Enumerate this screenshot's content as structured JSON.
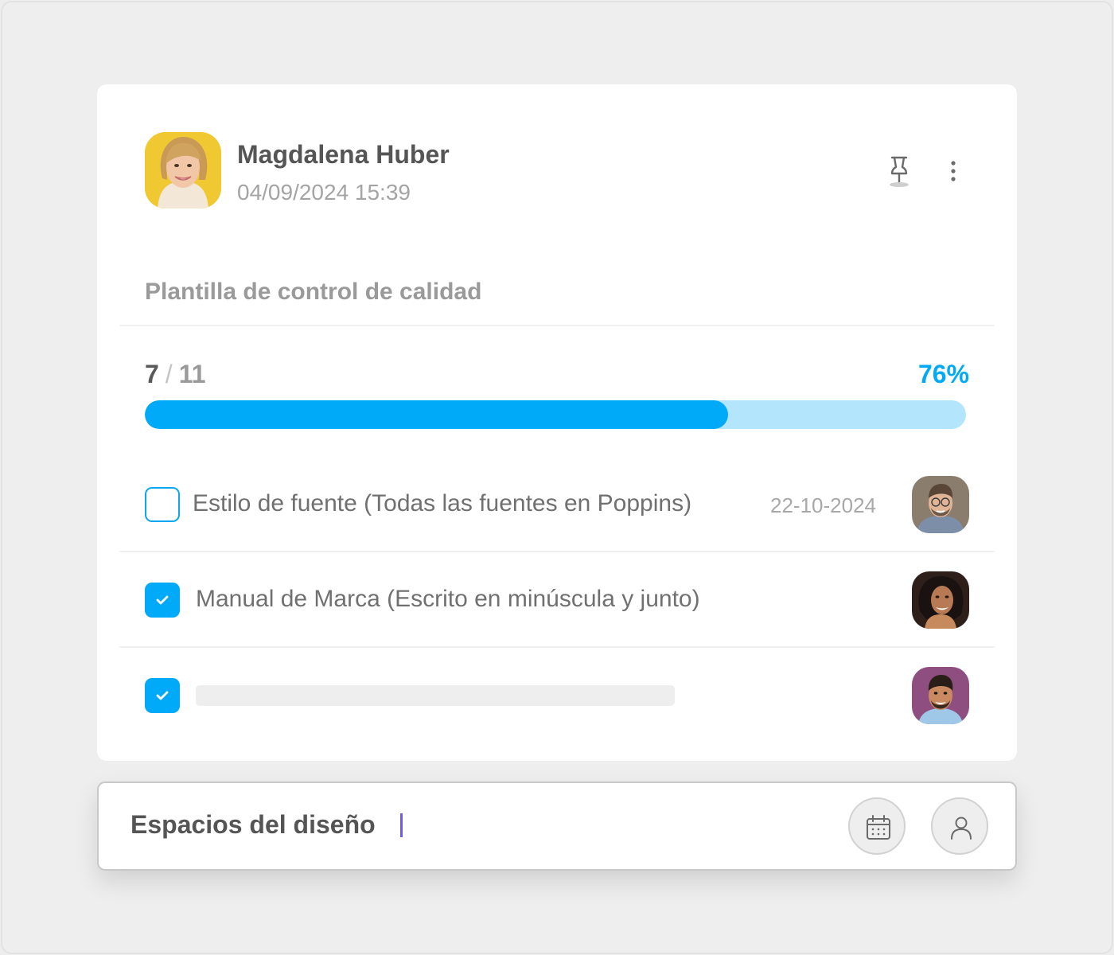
{
  "post": {
    "author": "Magdalena Huber",
    "timestamp": "04/09/2024 15:39"
  },
  "checklist": {
    "title": "Plantilla de control de calidad",
    "completed": "7",
    "separator": "/",
    "total": "11",
    "percent_label": "76%",
    "progress_fraction": 0.71,
    "tasks": [
      {
        "text": "Estilo de fuente (Todas las fuentes en Poppins)",
        "due_date": "22-10-2024",
        "checked": false
      },
      {
        "text": "Manual de Marca (Escrito en minúscula y junto)",
        "due_date": "",
        "checked": true
      },
      {
        "text": "",
        "due_date": "",
        "checked": true
      }
    ]
  },
  "composer": {
    "value": "Espacios del diseño"
  },
  "colors": {
    "accent": "#00aaf8",
    "progress_track": "#b3e6fd",
    "caret": "#6b5cf0"
  },
  "icons": [
    "pin-icon",
    "more-vertical-icon",
    "checkmark-icon",
    "calendar-icon",
    "user-icon"
  ]
}
